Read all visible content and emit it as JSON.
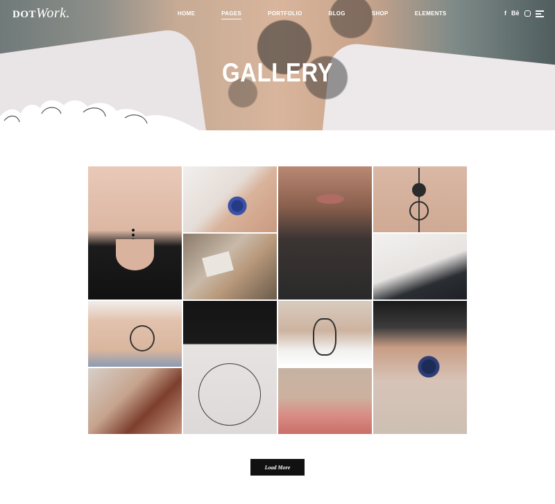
{
  "logo": {
    "text_a": "DOT",
    "text_b": "Work."
  },
  "nav": [
    {
      "label": "HOME"
    },
    {
      "label": "PAGES",
      "active": true
    },
    {
      "label": "PORTFOLIO"
    },
    {
      "label": "BLOG"
    },
    {
      "label": "SHOP"
    },
    {
      "label": "ELEMENTS"
    }
  ],
  "social": {
    "facebook": "f",
    "behance": "Bē",
    "instagram_icon": "instagram-icon"
  },
  "hero": {
    "title": "GALLERY"
  },
  "gallery": {
    "items": [
      {
        "icon": "image-icon"
      },
      {
        "icon": "image-icon"
      },
      {
        "icon": "image-icon"
      },
      {
        "icon": "image-icon"
      },
      {
        "icon": "image-icon"
      },
      {
        "icon": "image-icon"
      },
      {
        "icon": "image-icon"
      },
      {
        "icon": "image-icon"
      },
      {
        "icon": "image-icon"
      },
      {
        "icon": "image-icon"
      },
      {
        "icon": "image-icon"
      },
      {
        "icon": "image-icon"
      }
    ]
  },
  "load_more": {
    "label": "Load More"
  },
  "colors": {
    "button_bg": "#111111",
    "nav_text": "#ffffff",
    "page_bg": "#ffffff"
  }
}
